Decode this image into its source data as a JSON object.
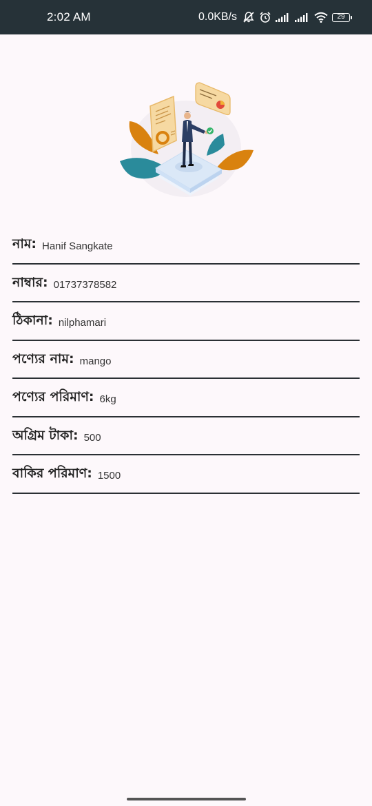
{
  "status_bar": {
    "time": "2:02 AM",
    "network_speed": "0.0KB/s",
    "battery_level": "29",
    "icons": [
      "muted-bell-icon",
      "alarm-icon",
      "signal-icon",
      "signal-icon",
      "wifi-icon",
      "battery-icon"
    ]
  },
  "illustration": {
    "icon": "businessman-documents-illustration",
    "colors": {
      "leaf_orange": "#d9820f",
      "leaf_teal": "#2a8b9b",
      "platform": "#dbe8f7",
      "document": "#f6d9a2",
      "suit": "#2c3e64"
    }
  },
  "fields": [
    {
      "label": "নাম:",
      "value": "Hanif Sangkate"
    },
    {
      "label": "নাম্বার:",
      "value": "01737378582"
    },
    {
      "label": "ঠিকানা:",
      "value": "nilphamari"
    },
    {
      "label": "পণ্যের নাম:",
      "value": "mango"
    },
    {
      "label": "পণ্যের পরিমাণ:",
      "value": "6kg"
    },
    {
      "label": "অগ্রিম টাকা:",
      "value": "500"
    },
    {
      "label": "বাকির পরিমাণ:",
      "value": "1500"
    }
  ],
  "colors": {
    "status_bar_bg": "#263238",
    "page_bg": "#fdf8fb",
    "divider": "#2b3034"
  }
}
